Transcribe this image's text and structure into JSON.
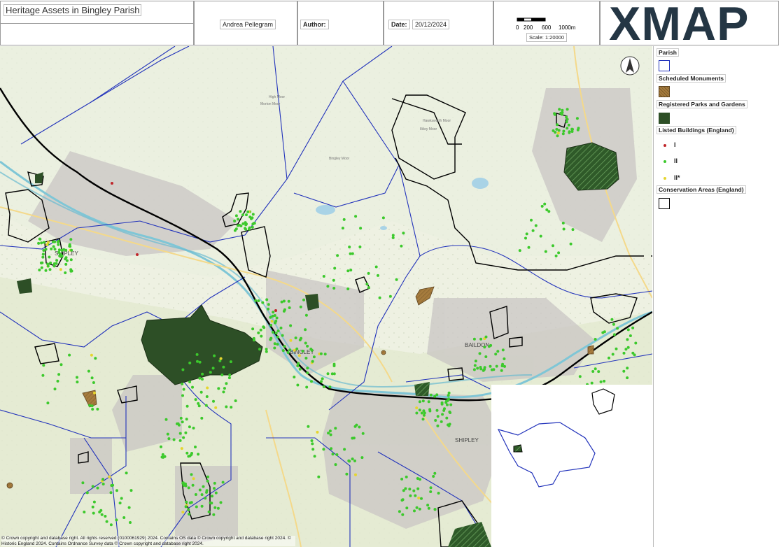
{
  "header": {
    "title": "Heritage Assets in Bingley Parish",
    "author_name": "Andrea Pellegram",
    "author_label": "Author:",
    "date_label": "Date:",
    "date_value": "20/12/2024",
    "scale_ticks": [
      "0",
      "200",
      "600",
      "1000m"
    ],
    "scale_text": "Scale: 1:20000",
    "logo_text": "XMAP"
  },
  "map": {
    "place_labels": [
      "SHIPLEY",
      "BINGLEY",
      "BAILDON",
      "SHIPLEY"
    ],
    "minor_labels": [
      "High Moor",
      "Morton Moor",
      "Bingley Moor",
      "Hawksworth Moor",
      "Ilkley Moor"
    ],
    "colors": {
      "parish_boundary": "#2233bb",
      "conservation_area": "#000000",
      "scheduled_monument": "#a57b3d",
      "registered_park": "#2d4f26",
      "listed_grade_I": "#c0262b",
      "listed_grade_II": "#3cc92c",
      "listed_grade_IIstar": "#e5d52f"
    },
    "copyright": "© Crown copyright and database right. All rights reserved (0100061929) 2024. Contains OS data © Crown copyright and database right 2024. © Historic England 2024. Contains Ordnance Survey data © Crown copyright and database right 2024."
  },
  "legend": {
    "parish": "Parish",
    "scheduled_monuments": "Scheduled Monuments",
    "registered_parks": "Registered Parks and Gardens",
    "listed_buildings": "Listed Buildings (England)",
    "grade_I": "I",
    "grade_II": "II",
    "grade_IIstar": "II*",
    "conservation_areas": "Conservation Areas (England)"
  }
}
